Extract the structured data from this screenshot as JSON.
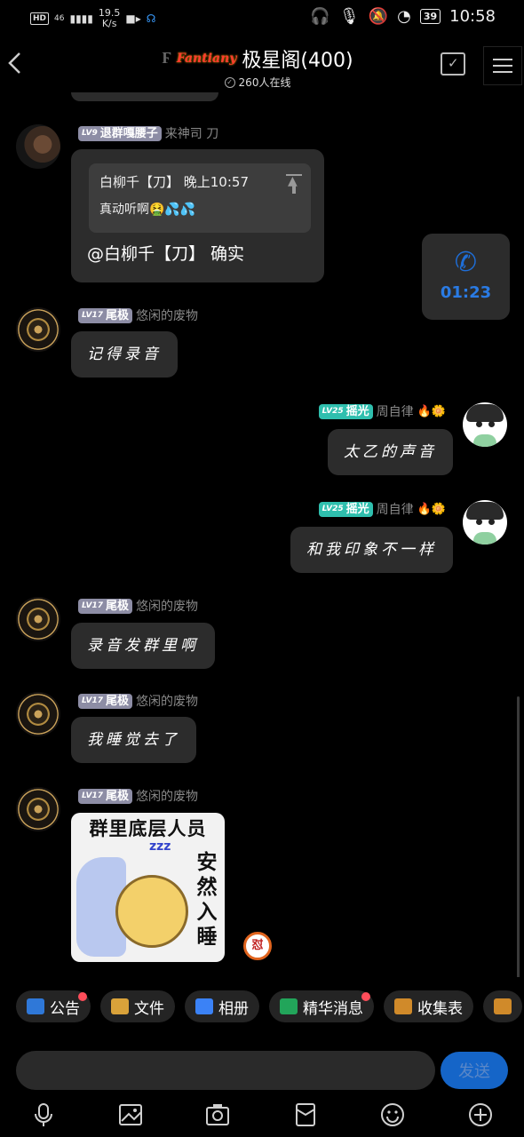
{
  "status_bar": {
    "hd": "HD",
    "network": "46",
    "speed_value": "19.5",
    "speed_unit": "K/s",
    "battery": "39",
    "time": "10:58"
  },
  "header": {
    "brand": "Fantiany",
    "title": "极星阁(400)",
    "online": "260人在线"
  },
  "messages": [
    {
      "sender_level": "LV9",
      "sender_title": "退群嘎腰子",
      "sender_name": "来神司  刀",
      "quote_line1": "白柳千【刀】 晚上10:57",
      "quote_line2": "真动听啊🤮💦💦",
      "text": "@白柳千【刀】 确实"
    },
    {
      "call_duration": "01:23"
    },
    {
      "sender_level": "LV17",
      "sender_title": "尾极",
      "sender_name": "悠闲的废物",
      "text": "记得录音"
    },
    {
      "sender_level": "LV25",
      "sender_title": "摇光",
      "sender_name": "周自律",
      "emojis": "🔥🌼",
      "text": "太乙的声音"
    },
    {
      "sender_level": "LV25",
      "sender_title": "摇光",
      "sender_name": "周自律",
      "emojis": "🔥🌼",
      "text": "和我印象不一样"
    },
    {
      "sender_level": "LV17",
      "sender_title": "尾极",
      "sender_name": "悠闲的废物",
      "text": "录音发群里啊"
    },
    {
      "sender_level": "LV17",
      "sender_title": "尾极",
      "sender_name": "悠闲的废物",
      "text": "我睡觉去了"
    },
    {
      "sender_level": "LV17",
      "sender_title": "尾极",
      "sender_name": "悠闲的废物",
      "sticker_top": "群里底层人员",
      "sticker_zz": "zzz",
      "sticker_side": "安然入睡",
      "reaction": "怼"
    }
  ],
  "chips": [
    {
      "label": "公告",
      "icon": "notice-icon",
      "unread": true
    },
    {
      "label": "文件",
      "icon": "folder-icon",
      "unread": false
    },
    {
      "label": "相册",
      "icon": "album-icon",
      "unread": false
    },
    {
      "label": "精华消息",
      "icon": "essence-icon",
      "unread": true
    },
    {
      "label": "收集表",
      "icon": "form-icon",
      "unread": false
    }
  ],
  "input": {
    "send_label": "发送"
  },
  "colors": {
    "accent": "#1565c8",
    "bubble": "#2c2c2c",
    "badge_gray": "#8d8da5",
    "badge_green": "#2fbfae"
  }
}
